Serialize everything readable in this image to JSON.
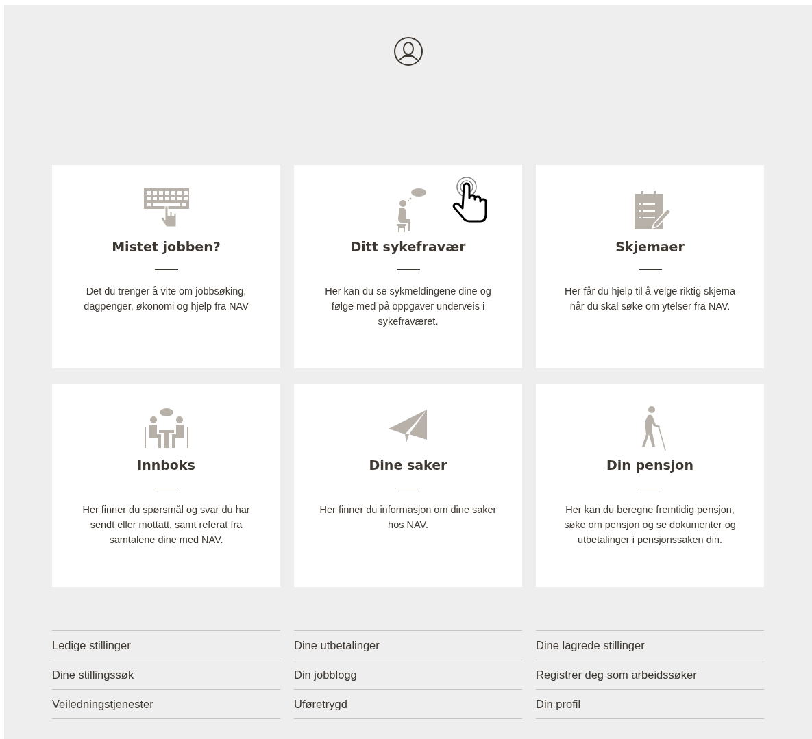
{
  "cards": [
    {
      "kind": "keyboard",
      "title": "Mistet jobben?",
      "text": "Det du trenger å vite om jobbsøking, dagpenger, økonomi og hjelp fra NAV"
    },
    {
      "kind": "thinker",
      "title": "Ditt sykefravær",
      "text": "Her kan du se sykmeldingene dine og følge med på oppgaver underveis i sykefraværet.",
      "hovered": true
    },
    {
      "kind": "form",
      "title": "Skjemaer",
      "text": "Her får du hjelp til å velge riktig skjema når du skal søke om ytelser fra NAV."
    },
    {
      "kind": "meeting",
      "title": "Innboks",
      "text": "Her finner du spørsmål og svar du har sendt eller mottatt, samt referat fra samtalene dine med NAV."
    },
    {
      "kind": "plane",
      "title": "Dine saker",
      "text": "Her finner du informasjon om dine saker hos NAV."
    },
    {
      "kind": "walker",
      "title": "Din pensjon",
      "text": "Her kan du beregne fremtidig pensjon, søke om pensjon og se dokumenter og utbetalinger i pensjonssaken din."
    }
  ],
  "link_columns": [
    [
      "Ledige stillinger",
      "Dine stillingssøk",
      "Veiledningstjenester"
    ],
    [
      "Dine utbetalinger",
      "Din jobblogg",
      "Uføretrygd"
    ],
    [
      "Dine lagrede stillinger",
      "Registrer deg som arbeidssøker",
      "Din profil"
    ]
  ]
}
